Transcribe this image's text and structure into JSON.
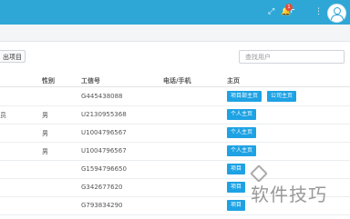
{
  "topbar": {
    "icons": [
      "expand-icon",
      "plus-icon",
      "bell-icon",
      "menu-icon",
      "avatar-icon"
    ],
    "notification_count": "1"
  },
  "toolbar": {
    "export_label": "出项目",
    "search_placeholder": "查找用户"
  },
  "table": {
    "headers": [
      "性别",
      "工信号",
      "电话/手机",
      "主页"
    ],
    "rows": [
      {
        "fragment": "",
        "gender": "",
        "id": "G445438088",
        "buttons": [
          "项目部主页",
          "公司主页"
        ]
      },
      {
        "fragment": "员",
        "gender": "男",
        "id": "U2130955368",
        "buttons": [
          "个人主页"
        ]
      },
      {
        "fragment": "",
        "gender": "男",
        "id": "U1004796567",
        "buttons": [
          "个人主页"
        ]
      },
      {
        "fragment": "",
        "gender": "男",
        "id": "U1004796567",
        "buttons": [
          "个人主页"
        ]
      },
      {
        "fragment": "",
        "gender": "",
        "id": "G1594796650",
        "buttons": [
          "项目"
        ]
      },
      {
        "fragment": "",
        "gender": "",
        "id": "G342677620",
        "buttons": [
          "项目"
        ]
      },
      {
        "fragment": "",
        "gender": "",
        "id": "G793834290",
        "buttons": [
          "项目"
        ]
      }
    ]
  },
  "watermark": {
    "text": "软件技巧"
  },
  "colors": {
    "topbar": "#2fa7d6",
    "button": "#1ea2e4"
  }
}
